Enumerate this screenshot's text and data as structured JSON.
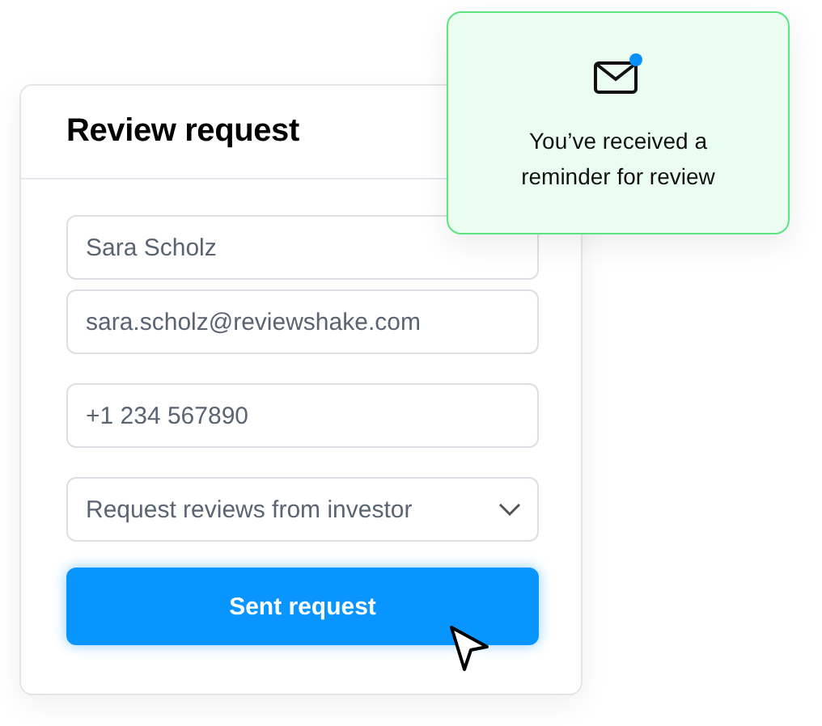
{
  "card": {
    "title": "Review request",
    "field_groups": [
      [
        {
          "kind": "text",
          "value": "Sara Scholz"
        },
        {
          "kind": "text",
          "value": "sara.scholz@reviewshake.com"
        }
      ],
      [
        {
          "kind": "text",
          "value": "+1 234 567890"
        }
      ],
      [
        {
          "kind": "select",
          "value": "Request reviews from investor"
        }
      ]
    ],
    "button": "Sent request"
  },
  "notification": {
    "message": "You’ve received a reminder for review",
    "unread": true
  }
}
